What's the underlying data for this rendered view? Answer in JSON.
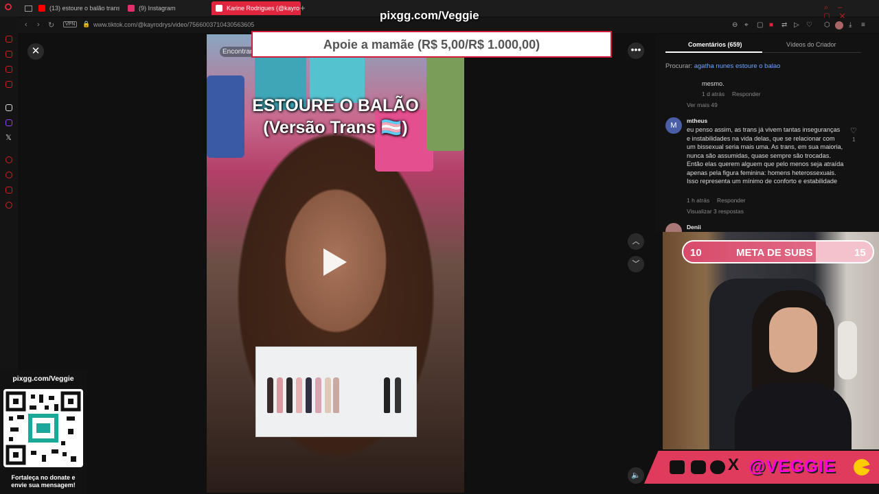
{
  "tabs": [
    {
      "label": "(13) estoure o balão trans",
      "icon": "youtube-icon",
      "color": "#ff0000"
    },
    {
      "label": "(9) Instagram",
      "icon": "instagram-icon",
      "color": "#e1306c"
    },
    {
      "label": "Karine Rodrigues (@kayro",
      "icon": "tiktok-icon",
      "color": "#ffffff"
    }
  ],
  "address": {
    "vpn_label": "VPN",
    "url": "www.tiktok.com/@kayrodrys/video/7566003710430563605"
  },
  "overlay": {
    "brand_top": "pixgg.com/Veggie",
    "banner": "Apoie a mamãe (R$ 5,00/R$ 1.000,00)"
  },
  "video": {
    "search_chip": "Encontrar",
    "title_line1": "ESTOURE O BALÃO",
    "title_line2": "(Versão Trans 🏳️‍⚧️)"
  },
  "comments_panel": {
    "tab_comments": "Comentários (659)",
    "tab_creator": "Vídeos do Criador",
    "search_label": "Procurar:",
    "search_term": "agatha nunes estoure o balao",
    "first": {
      "text": "mesmo.",
      "time": "1 d atrás",
      "reply": "Responder",
      "more": "Ver mais 49"
    },
    "second": {
      "avatar_letter": "M",
      "name": "mtheus",
      "text": "eu penso assim, as trans já vivem tantas inseguranças e instabilidades na vida delas, que se relacionar com um bissexual seria mais uma. As trans, em sua maioria, nunca são assumidas, quase sempre são trocadas. Então elas querem alguem que pelo menos seja atraída apenas pela figura feminina: homens heterossexuais. Isso representa um mínimo de conforto e estabilidade",
      "time": "1 h atrás",
      "reply": "Responder",
      "replies": "Visualizar 3 respostas",
      "likes": "1"
    },
    "third": {
      "name": "Denii"
    }
  },
  "sub_goal": {
    "current": "10",
    "label": "META DE SUBS",
    "target": "15"
  },
  "social": {
    "handle": "@VEGGIE"
  },
  "qr_card": {
    "title": "pixgg.com/Veggie",
    "footer_line1": "Fortaleça no donate e",
    "footer_line2": "envie sua mensagem!"
  }
}
